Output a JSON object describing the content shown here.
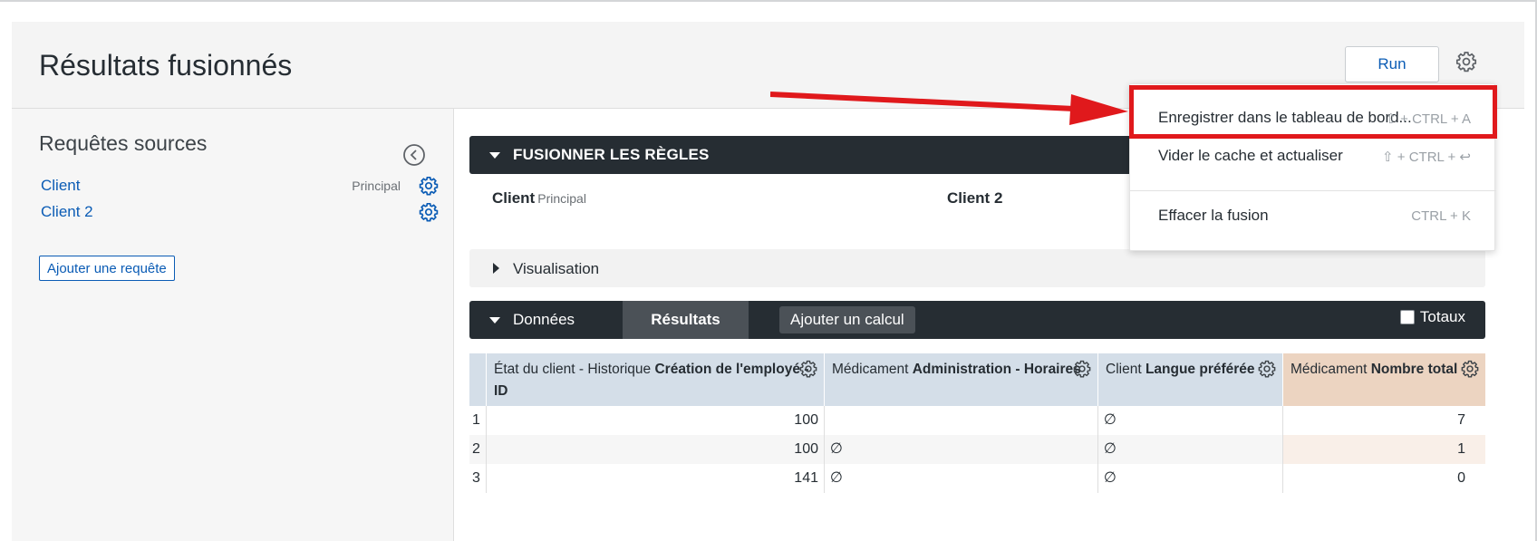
{
  "header": {
    "title": "Résultats fusionnés",
    "run_label": "Run",
    "settings_icon": "gear-icon"
  },
  "sidebar": {
    "title": "Requêtes sources",
    "collapse_icon": "chevron-left-circle-icon",
    "sources": [
      {
        "label": "Client",
        "badge": "Principal"
      },
      {
        "label": "Client 2",
        "badge": ""
      }
    ],
    "add_query_label": "Ajouter une requête"
  },
  "merge_rules": {
    "title": "FUSIONNER LES RÈGLES",
    "left_source": "Client",
    "left_badge": "Principal",
    "right_source": "Client 2"
  },
  "visualization": {
    "title": "Visualisation"
  },
  "data_bar": {
    "data_label": "Données",
    "results_tab": "Résultats",
    "add_calc_label": "Ajouter un calcul",
    "totals_label": "Totaux"
  },
  "table": {
    "columns": [
      {
        "prefix": "État du client - Historique ",
        "bold": "Création de l'employé - ID"
      },
      {
        "prefix": "Médicament ",
        "bold": "Administration - Horaires"
      },
      {
        "prefix": "Client ",
        "bold": "Langue préférée"
      },
      {
        "prefix": "Médicament ",
        "bold": "Nombre total"
      }
    ],
    "rows": [
      {
        "index": "1",
        "c1": "100",
        "c2": "",
        "c3": "∅",
        "c4": "7"
      },
      {
        "index": "2",
        "c1": "100",
        "c2": "∅",
        "c3": "∅",
        "c4": "1"
      },
      {
        "index": "3",
        "c1": "141",
        "c2": "∅",
        "c3": "∅",
        "c4": "0"
      }
    ]
  },
  "menu": {
    "items": [
      {
        "label": "Enregistrer dans le tableau de bord...",
        "shortcut": "⇧ + CTRL + A"
      },
      {
        "label": "Vider le cache et actualiser",
        "shortcut": "⇧ + CTRL + ↩"
      },
      {
        "label": "Effacer la fusion",
        "shortcut": "CTRL + K"
      }
    ]
  },
  "annotation": {
    "color": "#e0191c"
  }
}
